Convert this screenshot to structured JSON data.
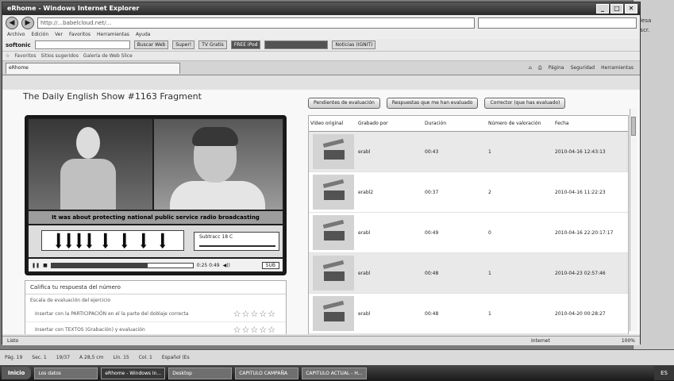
{
  "browser": {
    "title": "eRhome - Windows Internet Explorer",
    "address": "http://...babelcloud.net/...",
    "search_placeholder": "",
    "menu": [
      "Archivo",
      "Edición",
      "Ver",
      "Favoritos",
      "Herramientas",
      "Ayuda"
    ],
    "toolbar_brand": "softonic",
    "toolbar_search_btn": "Buscar Web",
    "toolbar_items": [
      "Super!",
      "TV Gratis",
      "FREE iPod",
      "Noticias (IGNIT)"
    ],
    "fav_items": [
      "Favoritos",
      "Sitios sugeridos",
      "Galería de Web Slice"
    ],
    "tab_label": "eRhome",
    "cmd_items": [
      "Página",
      "Seguridad",
      "Herramientas"
    ],
    "status_left": "Listo",
    "status_zone": "Internet",
    "zoom": "100%"
  },
  "player": {
    "show_title": "The Daily English Show #1163 Fragment",
    "caption": "It was about protecting national public service radio broadcasting",
    "volume_label": "Subtracc 18 C",
    "time_display": "0:25 0:49",
    "hd_label": "SUB",
    "progress": 0.68
  },
  "rating": {
    "heading": "Califica tu respuesta del número",
    "subheading": "Escala de evaluación del ejercicio",
    "rows": [
      {
        "label": "Insertar con la PARTICIPACIÓN en el la parte del doblaje correcta",
        "stars": "☆☆☆☆☆"
      },
      {
        "label": "Insertar con TEXTOS (Grabación) y evaluación",
        "stars": "☆☆☆☆☆"
      }
    ]
  },
  "tabs_right": [
    "Pendientes de evaluación",
    "Respuestas que me han evaluado",
    "Corrector (que has evaluado)"
  ],
  "grid": {
    "headers": [
      "Vídeo original",
      "Grabado por",
      "Duración",
      "Número de valoración",
      "Fecha"
    ],
    "rows": [
      {
        "user": "erabl",
        "duration": "00:43",
        "count": "1",
        "date": "2010-04-16 12:43:13"
      },
      {
        "user": "erabl2",
        "duration": "00:37",
        "count": "2",
        "date": "2010-04-16 11:22:23"
      },
      {
        "user": "erabl",
        "duration": "00:49",
        "count": "0",
        "date": "2010-04-16 22:20:17:17"
      },
      {
        "user": "erabl",
        "duration": "00:48",
        "count": "1",
        "date": "2010-04-23 02:57:46"
      },
      {
        "user": "erabl",
        "duration": "00:48",
        "count": "1",
        "date": "2010-04-20 00:28:27"
      }
    ]
  },
  "apps_strip": [
    "Pág. 19",
    "Sec. 1",
    "19/37",
    "A 28,5 cm",
    "Lín. 15",
    "Col. 1",
    "Español (Es"
  ],
  "taskbar": {
    "start": "Inicio",
    "tasks": [
      "Los datos",
      "eRhome - Windows In...",
      "Desktop",
      "CAPITULO CAMPAÑA",
      "CAPITULO ACTUAL - H..."
    ],
    "tray": "ES"
  },
  "desktop_right": [
    "Mesa",
    "Escr."
  ]
}
